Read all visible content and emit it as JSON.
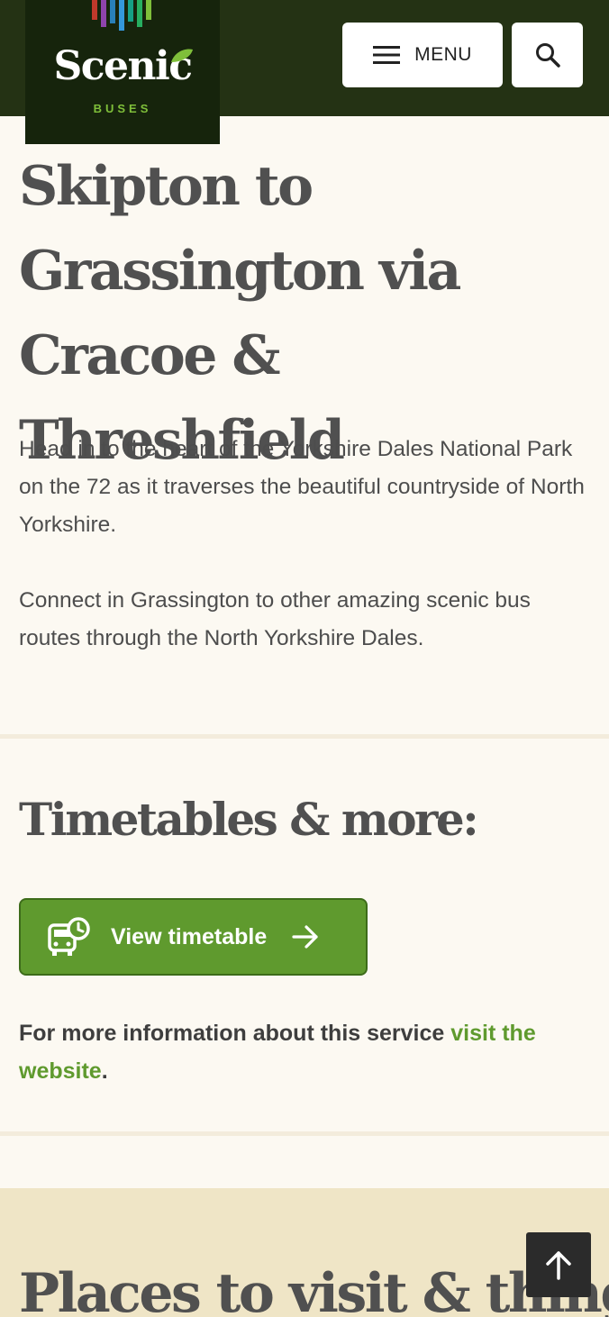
{
  "header": {
    "logo": {
      "word": "Scenic",
      "sub": "BUSES"
    },
    "menu_label": "MENU"
  },
  "hero": {
    "title": "Skipton to Grassington via Cracoe & Threshfield",
    "paragraphs": [
      "Head in to the heart of the Yorkshire Dales National Park on the 72 as it traverses the beautiful countryside of North Yorkshire.",
      "Connect in Grassington to other amazing scenic bus routes through the North Yorkshire Dales."
    ]
  },
  "timetables": {
    "heading": "Timetables & more:",
    "button_label": "View timetable",
    "info_text": "For more information about this service ",
    "info_link": "visit the website",
    "info_end": "."
  },
  "places": {
    "heading": "Places to visit & things"
  },
  "colors": {
    "header_bg": "#243214",
    "logo_bg": "#16240c",
    "accent_green": "#5f9a2e",
    "page_bg": "#fcf9f2",
    "places_bg": "#efe5c6"
  },
  "icons": [
    "hamburger-icon",
    "search-icon",
    "bus-clock-icon",
    "arrow-right-icon",
    "arrow-up-icon"
  ]
}
